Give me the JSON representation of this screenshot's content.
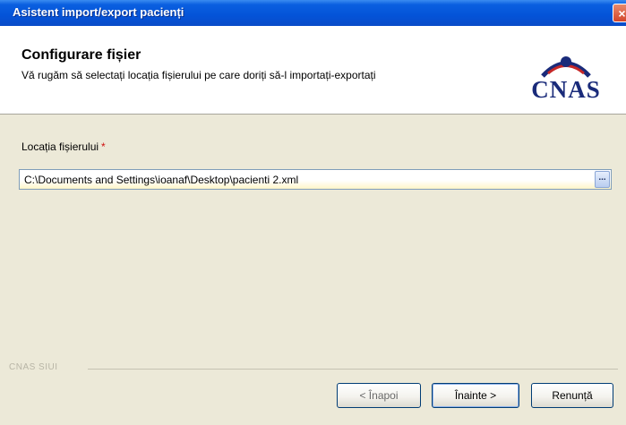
{
  "window": {
    "title": "Asistent import/export pacienți",
    "close_glyph": "×"
  },
  "header": {
    "title": "Configurare fișier",
    "subtitle": "Vă rugăm să selectați locația fișierului pe care doriți să-l importați-exportați",
    "logo_text": "CNAS"
  },
  "form": {
    "location_label": "Locația fișierului",
    "required_mark": "*",
    "location_value": "C:\\Documents and Settings\\ioanaf\\Desktop\\pacienti 2.xml",
    "browse_label": "..."
  },
  "footer": {
    "group_label": "CNAS SIUI"
  },
  "buttons": {
    "back_label": "< Înapoi",
    "next_label": "Înainte >",
    "cancel_label": "Renunță"
  },
  "colors": {
    "titlebar": "#0453d8",
    "window_bg": "#ece9d8",
    "logo_blue": "#1a2b7a",
    "logo_red": "#c62828"
  }
}
